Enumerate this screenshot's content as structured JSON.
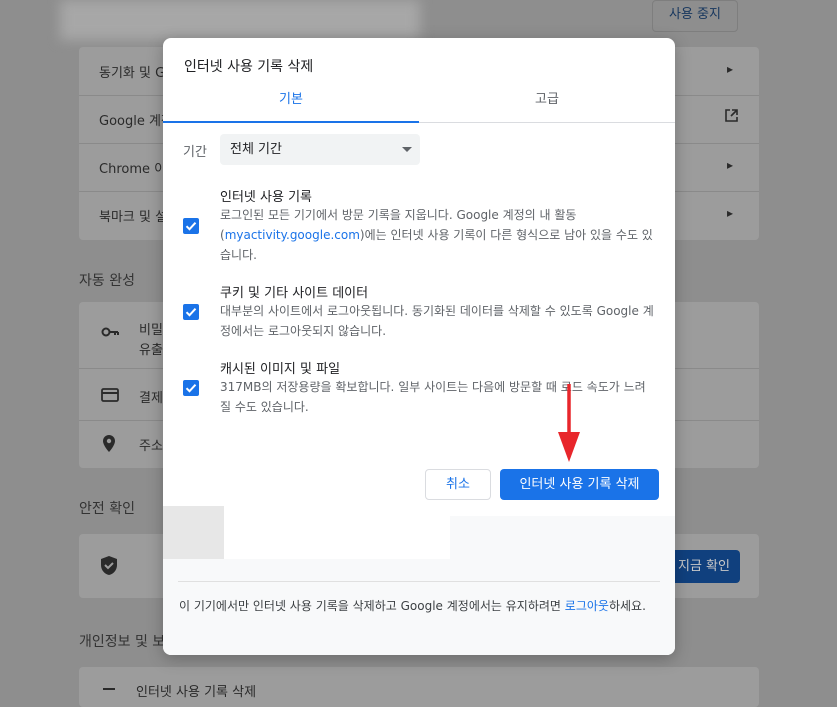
{
  "background": {
    "top_button_label": "사용 중지",
    "rows": [
      {
        "label": "동기화 및 G",
        "trailing": "chevron-right-icon"
      },
      {
        "label": "Google 계정",
        "trailing": "open-in-new-icon"
      },
      {
        "label": "Chrome 이",
        "trailing": "chevron-right-icon"
      },
      {
        "label": "북마크 및 설",
        "trailing": "chevron-right-icon"
      }
    ],
    "autofill_section": "자동 완성",
    "autofill_rows": [
      {
        "icon": "key-icon",
        "label": "비밀",
        "sublabel": "유출"
      },
      {
        "icon": "credit-card-icon",
        "label": "결제"
      },
      {
        "icon": "location-pin-icon",
        "label": "주소"
      }
    ],
    "safety_section": "안전 확인",
    "safety_button_label": "지금 확인",
    "privacy_section": "개인정보 및 보",
    "bottom_row_label": "인터넷 사용 기록 삭제"
  },
  "dialog": {
    "title": "인터넷 사용 기록 삭제",
    "tabs": [
      {
        "label": "기본",
        "active": true
      },
      {
        "label": "고급",
        "active": false
      }
    ],
    "period": {
      "label": "기간",
      "selected": "전체 기간"
    },
    "options": [
      {
        "checked": true,
        "title": "인터넷 사용 기록",
        "desc_before": "로그인된 모든 기기에서 방문 기록을 지웁니다. Google 계정의 내 활동 (",
        "desc_link": "myactivity.google.com",
        "desc_after": ")에는 인터넷 사용 기록이 다른 형식으로 남아 있을 수도 있습니다."
      },
      {
        "checked": true,
        "title": "쿠키 및 기타 사이트 데이터",
        "desc": "대부분의 사이트에서 로그아웃됩니다. 동기화된 데이터를 삭제할 수 있도록 Google 계정에서는 로그아웃되지 않습니다."
      },
      {
        "checked": true,
        "title": "캐시된 이미지 및 파일",
        "desc": "317MB의 저장용량을 확보합니다. 일부 사이트는 다음에 방문할 때 로드 속도가 느려질 수도 있습니다."
      }
    ],
    "cancel_label": "취소",
    "delete_label": "인터넷 사용 기록 삭제",
    "footer_text_before": "이 기기에서만 인터넷 사용 기록을 삭제하고 Google 계정에서는 유지하려면 ",
    "footer_link": "로그아웃",
    "footer_text_after": "하세요."
  },
  "colors": {
    "accent": "#1a73e8",
    "annotation_arrow": "#e8262b"
  }
}
